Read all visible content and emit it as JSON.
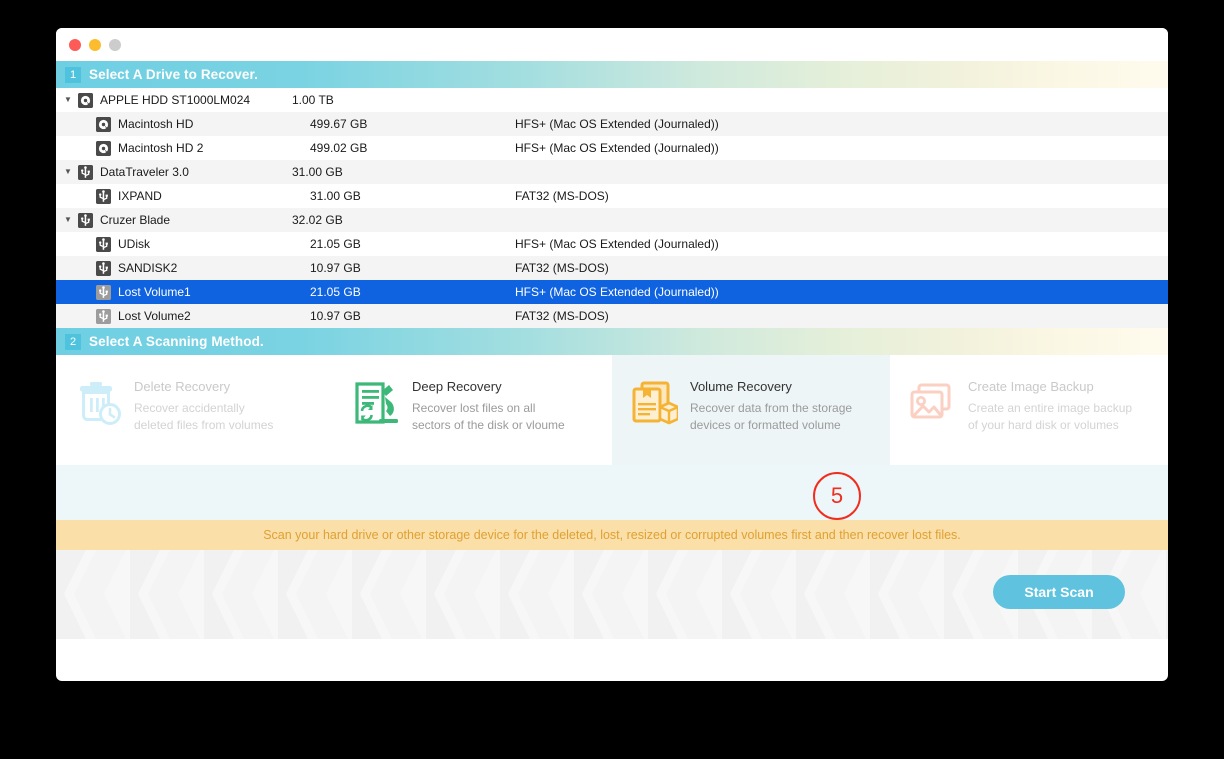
{
  "window": {
    "traffic_lights": [
      "close",
      "minimize",
      "zoom"
    ],
    "colors": {
      "close": "#FC5B57",
      "minimize": "#FCBC2D",
      "zoom": "#CCCCCC",
      "selected_row": "#0F62E0",
      "accent_cyan": "#5FC3DF",
      "notice_bg": "#FADFA8",
      "notice_text": "#E0A132",
      "annotation_red": "#F02D1E",
      "selected_card_bg": "#EDF5F7"
    }
  },
  "step1": {
    "badge": "1",
    "title": "Select A Drive to Recover."
  },
  "drives": [
    {
      "name": "APPLE HDD ST1000LM024",
      "size": "1.00 TB",
      "fs": "",
      "level": "parent",
      "icon": "hard-disk-icon",
      "expanded": true,
      "selected": false,
      "dimmed": false
    },
    {
      "name": "Macintosh HD",
      "size": "499.67 GB",
      "fs": "HFS+ (Mac OS Extended (Journaled))",
      "level": "child",
      "icon": "hard-disk-icon",
      "expanded": false,
      "selected": false,
      "dimmed": false
    },
    {
      "name": "Macintosh HD 2",
      "size": "499.02 GB",
      "fs": "HFS+ (Mac OS Extended (Journaled))",
      "level": "child",
      "icon": "hard-disk-icon",
      "expanded": false,
      "selected": false,
      "dimmed": false
    },
    {
      "name": "DataTraveler 3.0",
      "size": "31.00 GB",
      "fs": "",
      "level": "parent",
      "icon": "usb-drive-icon",
      "expanded": true,
      "selected": false,
      "dimmed": false
    },
    {
      "name": "IXPAND",
      "size": "31.00 GB",
      "fs": "FAT32 (MS-DOS)",
      "level": "child",
      "icon": "usb-drive-icon",
      "expanded": false,
      "selected": false,
      "dimmed": false
    },
    {
      "name": "Cruzer Blade",
      "size": "32.02 GB",
      "fs": "",
      "level": "parent",
      "icon": "usb-drive-icon",
      "expanded": true,
      "selected": false,
      "dimmed": false
    },
    {
      "name": "UDisk",
      "size": "21.05 GB",
      "fs": "HFS+ (Mac OS Extended (Journaled))",
      "level": "child",
      "icon": "usb-drive-icon",
      "expanded": false,
      "selected": false,
      "dimmed": false
    },
    {
      "name": "SANDISK2",
      "size": "10.97 GB",
      "fs": "FAT32 (MS-DOS)",
      "level": "child",
      "icon": "usb-drive-icon",
      "expanded": false,
      "selected": false,
      "dimmed": false
    },
    {
      "name": "Lost Volume1",
      "size": "21.05 GB",
      "fs": "HFS+ (Mac OS Extended (Journaled))",
      "level": "child",
      "icon": "usb-drive-icon",
      "expanded": false,
      "selected": true,
      "dimmed": true
    },
    {
      "name": "Lost Volume2",
      "size": "10.97 GB",
      "fs": "FAT32 (MS-DOS)",
      "level": "child",
      "icon": "usb-drive-icon",
      "expanded": false,
      "selected": false,
      "dimmed": true
    }
  ],
  "step2": {
    "badge": "2",
    "title": "Select A Scanning Method."
  },
  "methods": [
    {
      "title": "Delete Recovery",
      "desc_line1": "Recover accidentally",
      "desc_line2": "deleted files from volumes",
      "icon": "trash-clock-icon",
      "state": "disabled",
      "color": "#CDEEF8"
    },
    {
      "title": "Deep Recovery",
      "desc_line1": "Recover lost files on all",
      "desc_line2": "sectors of the disk or vloume",
      "icon": "document-microscope-icon",
      "state": "enabled",
      "color": "#3CB878"
    },
    {
      "title": "Volume Recovery",
      "desc_line1": "Recover data from the storage",
      "desc_line2": "devices or formatted volume",
      "icon": "document-box-icon",
      "state": "selected",
      "color": "#F5B335"
    },
    {
      "title": "Create Image Backup",
      "desc_line1": "Create an entire image backup",
      "desc_line2": "of your hard disk or volumes",
      "icon": "photo-stack-icon",
      "state": "disabled",
      "color": "#FBD0C3"
    }
  ],
  "notice": {
    "text": "Scan your hard drive or other storage device for the deleted, lost, resized or corrupted volumes first and then recover lost files."
  },
  "footer": {
    "start_scan_label": "Start Scan"
  },
  "annotation": {
    "number": "5"
  }
}
